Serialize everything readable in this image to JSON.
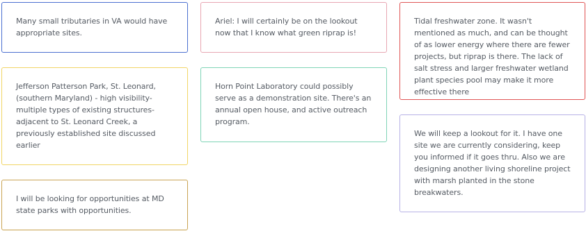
{
  "notes": [
    {
      "id": "va-tributaries",
      "text": "Many small tributaries in VA would have appropriate sites.",
      "border_color": "#4a6fd0"
    },
    {
      "id": "jefferson-patterson",
      "text": "Jefferson Patterson Park, St. Leonard, (southern Maryland) - high visibility- multiple types of existing structures- adjacent to St. Leonard Creek, a previously established site discussed earlier",
      "border_color": "#f1d565"
    },
    {
      "id": "md-state-parks",
      "text": "I will be looking for opportunities at MD state parks with opportunities.",
      "border_color": "#c9a352"
    },
    {
      "id": "ariel-green-riprap",
      "text": "Ariel: I will certainly be on the lookout now that I know what green riprap is!",
      "border_color": "#e8a6b2"
    },
    {
      "id": "horn-point",
      "text": "Horn Point Laboratory could possibly serve as a demonstration site. There's an annual open house, and active outreach program.",
      "border_color": "#7fd4b6"
    },
    {
      "id": "tidal-freshwater",
      "text": "Tidal freshwater zone. It wasn't mentioned as much, and can be thought of as lower energy where there are fewer projects, but riprap is there. The lack of salt stress and larger freshwater wetland plant species pool may make it more effective there",
      "border_color": "#e05555"
    },
    {
      "id": "living-shoreline",
      "text": "We will keep a lookout for it. I have one site we are currently considering, keep you informed if it goes thru. Also we are designing another living shoreline project with marsh planted in the stone breakwaters.",
      "border_color": "#b7b2e6"
    }
  ]
}
